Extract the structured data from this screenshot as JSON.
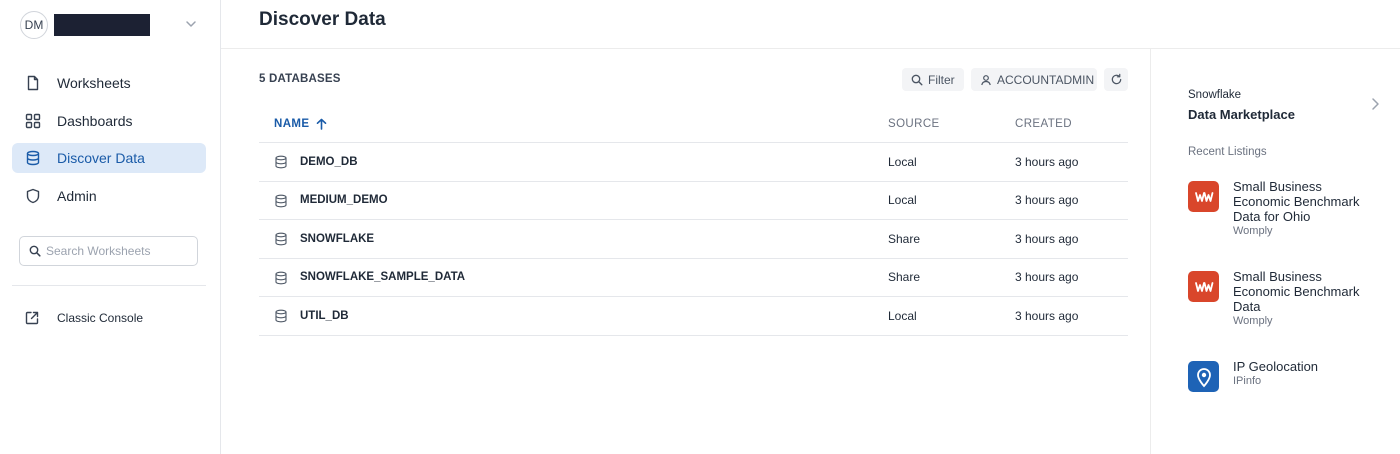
{
  "user": {
    "initials": "DM"
  },
  "sidebar": {
    "items": [
      {
        "label": "Worksheets",
        "icon": "document-icon"
      },
      {
        "label": "Dashboards",
        "icon": "grid-icon"
      },
      {
        "label": "Discover Data",
        "icon": "database-icon",
        "active": true
      },
      {
        "label": "Admin",
        "icon": "shield-icon"
      }
    ],
    "search": {
      "placeholder": "Search Worksheets"
    },
    "classic_console": "Classic Console"
  },
  "header": {
    "title": "Discover Data"
  },
  "main": {
    "count_label": "5 DATABASES",
    "filter_label": "Filter",
    "role_label": "ACCOUNTADMIN",
    "columns": {
      "name": "NAME",
      "source": "SOURCE",
      "created": "CREATED"
    },
    "rows": [
      {
        "name": "DEMO_DB",
        "source": "Local",
        "created": "3 hours ago"
      },
      {
        "name": "MEDIUM_DEMO",
        "source": "Local",
        "created": "3 hours ago"
      },
      {
        "name": "SNOWFLAKE",
        "source": "Share",
        "created": "3 hours ago"
      },
      {
        "name": "SNOWFLAKE_SAMPLE_DATA",
        "source": "Share",
        "created": "3 hours ago"
      },
      {
        "name": "UTIL_DB",
        "source": "Local",
        "created": "3 hours ago"
      }
    ]
  },
  "marketplace": {
    "brand": "Snowflake",
    "title": "Data Marketplace",
    "recent_label": "Recent Listings",
    "listings": [
      {
        "title": "Small Business Economic Benchmark Data for Ohio",
        "provider": "Womply",
        "logo_color": "#d9462b"
      },
      {
        "title": "Small Business Economic Benchmark Data",
        "provider": "Womply",
        "logo_color": "#d9462b"
      },
      {
        "title": "IP Geolocation",
        "provider": "IPinfo",
        "logo_color": "#1e63b6"
      }
    ]
  },
  "colors": {
    "accent": "#1a5ba8",
    "active_bg": "#dde9f8"
  }
}
